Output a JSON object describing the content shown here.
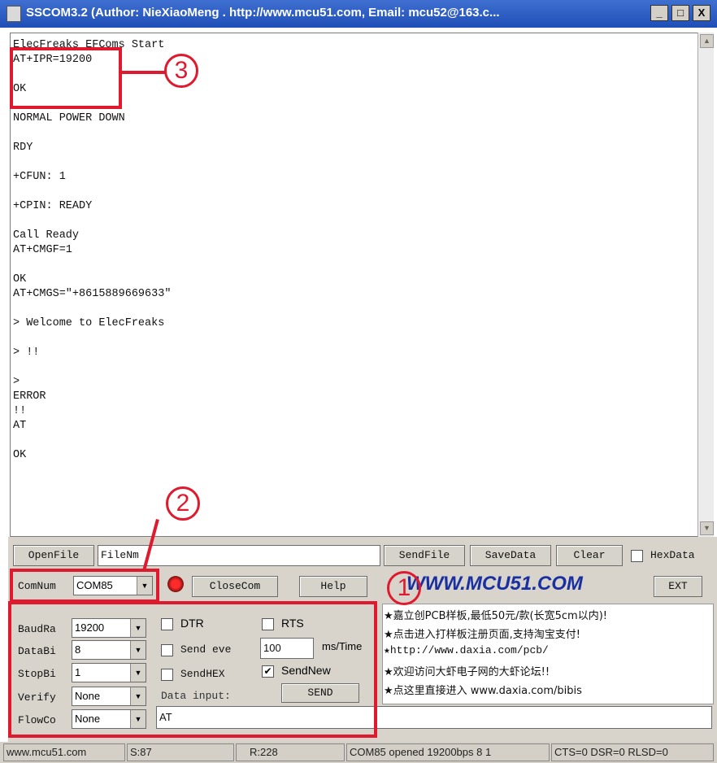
{
  "window": {
    "title": "SSCOM3.2 (Author: NieXiaoMeng . http://www.mcu51.com, Email: mcu52@163.c...",
    "min_label": "_",
    "max_label": "□",
    "close_label": "X"
  },
  "terminal": {
    "lines": [
      "ElecFreaks EFComs Start",
      "AT+IPR=19200",
      "",
      "OK",
      "",
      "NORMAL POWER DOWN",
      "",
      "RDY",
      "",
      "+CFUN: 1",
      "",
      "+CPIN: READY",
      "",
      "Call Ready",
      "AT+CMGF=1",
      "",
      "OK",
      "AT+CMGS=\"+8615889669633\"",
      "",
      "> Welcome to ElecFreaks",
      "",
      "> !!",
      "",
      ">",
      "ERROR",
      "!!",
      "AT",
      "",
      "OK"
    ]
  },
  "toolbar": {
    "openfile": "OpenFile",
    "filename": "FileNm",
    "sendfile": "SendFile",
    "savedata": "SaveData",
    "clear": "Clear",
    "hexdata": "HexData",
    "comnum_label": "ComNum",
    "comnum_value": "COM85",
    "closecom": "CloseCom",
    "help": "Help",
    "logo": "WWW.MCU51.COM",
    "ext": "EXT"
  },
  "settings": {
    "baud_label": "BaudRa",
    "baud_value": "19200",
    "databits_label": "DataBi",
    "databits_value": "8",
    "stopbits_label": "StopBi",
    "stopbits_value": "1",
    "verify_label": "Verify",
    "verify_value": "None",
    "flow_label": "FlowCo",
    "flow_value": "None"
  },
  "options": {
    "dtr": "DTR",
    "rts": "RTS",
    "send_every": "Send eve",
    "interval": "100",
    "interval_unit": "ms/Time",
    "sendhex": "SendHEX",
    "sendnew": "SendNew",
    "data_input_label": "Data input:",
    "send": "SEND",
    "input_value": "AT"
  },
  "ads": [
    "★嘉立创PCB样板,最低50元/款(长宽5cm以内)!",
    "★点击进入打样板注册页面,支持淘宝支付!",
    "★http://www.daxia.com/pcb/",
    "★欢迎访问大虾电子网的大虾论坛!!",
    "★点这里直接进入 www.daxia.com/bibis"
  ],
  "status": {
    "site": "www.mcu51.com",
    "sent": "S:87",
    "received": "R:228",
    "port": "COM85 opened 19200bps 8 1",
    "lines": "CTS=0 DSR=0 RLSD=0"
  },
  "annotations": {
    "one": "1",
    "two": "2",
    "three": "3"
  },
  "colors": {
    "annotation": "#e01a2e",
    "title_bar": "#2a5bc4"
  }
}
